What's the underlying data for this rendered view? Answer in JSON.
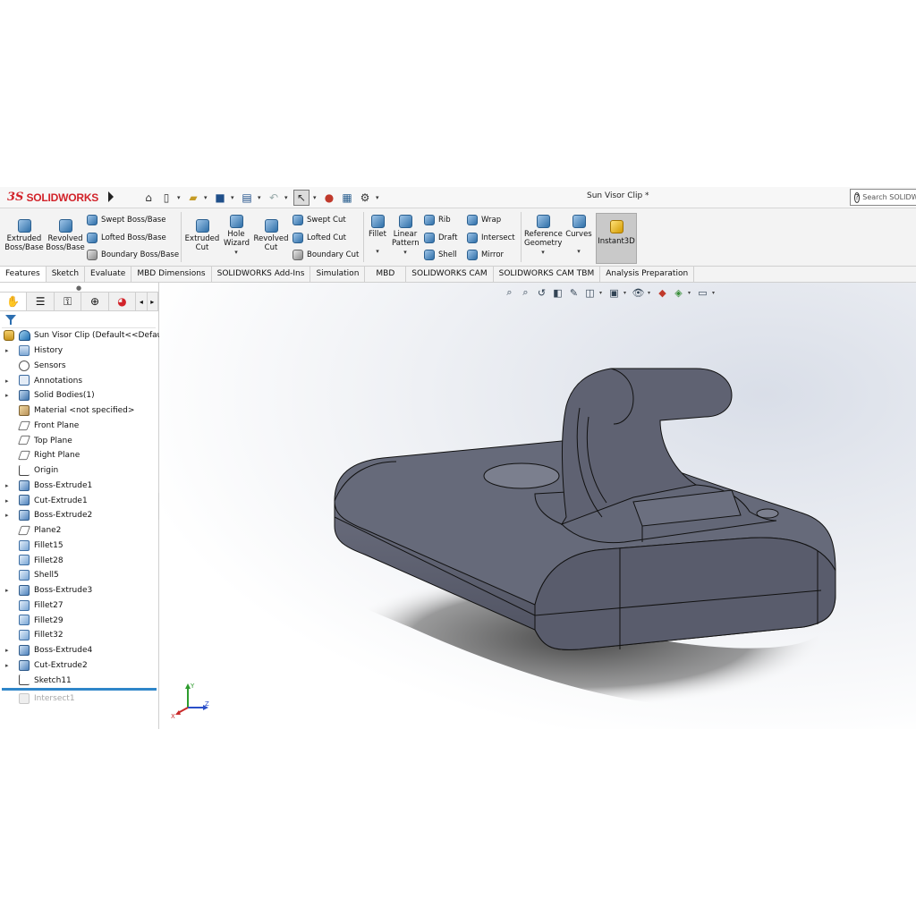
{
  "app": {
    "brand_prefix": "3S",
    "brand": "SOLIDWORKS",
    "doc_title": "Sun Visor Clip *",
    "search_placeholder": "Search SOLIDWORKS"
  },
  "quick_access": {
    "icons": [
      "home-icon",
      "new-document-icon",
      "open-folder-icon",
      "save-icon",
      "print-icon",
      "undo-icon",
      "select-arrow-icon",
      "traffic-light-icon",
      "file-properties-icon",
      "options-gear-icon"
    ]
  },
  "ribbon": {
    "extruded_boss": "Extruded Boss/Base",
    "revolved_boss": "Revolved Boss/Base",
    "swept_boss": "Swept Boss/Base",
    "lofted_boss": "Lofted Boss/Base",
    "boundary_boss": "Boundary Boss/Base",
    "extruded_cut": "Extruded Cut",
    "hole_wizard": "Hole Wizard",
    "revolved_cut": "Revolved Cut",
    "swept_cut": "Swept Cut",
    "lofted_cut": "Lofted Cut",
    "boundary_cut": "Boundary Cut",
    "fillet": "Fillet",
    "linear_pattern": "Linear Pattern",
    "rib": "Rib",
    "draft": "Draft",
    "shell": "Shell",
    "wrap": "Wrap",
    "intersect": "Intersect",
    "mirror": "Mirror",
    "reference_geometry": "Reference Geometry",
    "curves": "Curves",
    "instant3d": "Instant3D"
  },
  "tabs": [
    "Features",
    "Sketch",
    "Evaluate",
    "MBD Dimensions",
    "SOLIDWORKS Add-Ins",
    "Simulation",
    "MBD",
    "SOLIDWORKS CAM",
    "SOLIDWORKS CAM TBM",
    "Analysis Preparation"
  ],
  "active_tab": "Features",
  "tree": {
    "root": "Sun Visor Clip  (Default<<Default>",
    "items": [
      {
        "label": "History",
        "expandable": true,
        "icon": "history-folder-icon"
      },
      {
        "label": "Sensors",
        "expandable": false,
        "icon": "sensors-icon"
      },
      {
        "label": "Annotations",
        "expandable": true,
        "icon": "annotations-icon"
      },
      {
        "label": "Solid Bodies(1)",
        "expandable": true,
        "icon": "solid-bodies-icon"
      },
      {
        "label": "Material <not specified>",
        "expandable": false,
        "icon": "material-icon"
      },
      {
        "label": "Front Plane",
        "expandable": false,
        "icon": "plane-icon"
      },
      {
        "label": "Top Plane",
        "expandable": false,
        "icon": "plane-icon"
      },
      {
        "label": "Right Plane",
        "expandable": false,
        "icon": "plane-icon"
      },
      {
        "label": "Origin",
        "expandable": false,
        "icon": "origin-icon"
      },
      {
        "label": "Boss-Extrude1",
        "expandable": true,
        "icon": "boss-extrude-icon"
      },
      {
        "label": "Cut-Extrude1",
        "expandable": true,
        "icon": "cut-extrude-icon"
      },
      {
        "label": "Boss-Extrude2",
        "expandable": true,
        "icon": "boss-extrude-icon"
      },
      {
        "label": "Plane2",
        "expandable": false,
        "icon": "plane-icon"
      },
      {
        "label": "Fillet15",
        "expandable": false,
        "icon": "fillet-icon"
      },
      {
        "label": "Fillet28",
        "expandable": false,
        "icon": "fillet-icon"
      },
      {
        "label": "Shell5",
        "expandable": false,
        "icon": "shell-icon"
      },
      {
        "label": "Boss-Extrude3",
        "expandable": true,
        "icon": "boss-extrude-icon"
      },
      {
        "label": "Fillet27",
        "expandable": false,
        "icon": "fillet-icon"
      },
      {
        "label": "Fillet29",
        "expandable": false,
        "icon": "fillet-icon"
      },
      {
        "label": "Fillet32",
        "expandable": false,
        "icon": "fillet-icon"
      },
      {
        "label": "Boss-Extrude4",
        "expandable": true,
        "icon": "boss-extrude-icon"
      },
      {
        "label": "Cut-Extrude2",
        "expandable": true,
        "icon": "cut-extrude-icon"
      },
      {
        "label": "Sketch11",
        "expandable": false,
        "icon": "sketch-icon"
      }
    ],
    "suppressed_item": "Intersect1"
  },
  "triad": {
    "x": "X",
    "y": "Y",
    "z": "Z"
  },
  "colors": {
    "model": "#5f6272",
    "brand_red": "#d2232a",
    "rollback_bar": "#2f86c9"
  }
}
